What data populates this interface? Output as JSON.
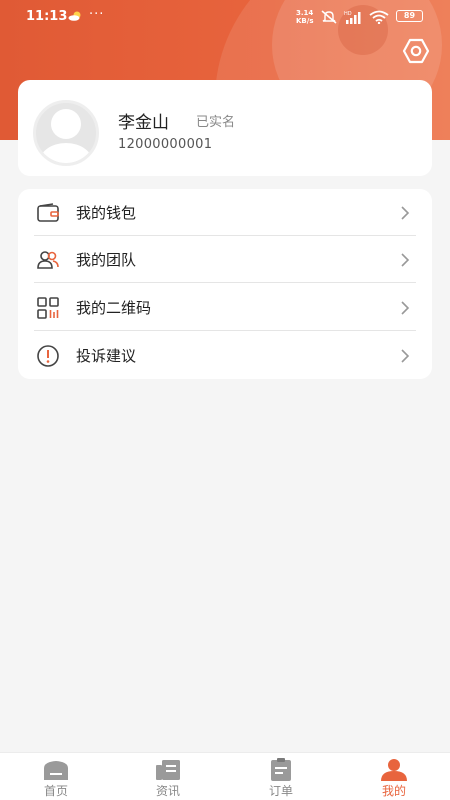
{
  "status_bar": {
    "time": "11:13",
    "more_dots": "···",
    "net_speed_value": "3.14",
    "net_speed_unit": "KB/s",
    "signal_label": "HD",
    "battery": "89"
  },
  "profile": {
    "name": "李金山",
    "verified_label": "已实名",
    "phone": "12000000001"
  },
  "menu": {
    "items": [
      {
        "label": "我的钱包",
        "icon": "wallet-icon"
      },
      {
        "label": "我的团队",
        "icon": "team-icon"
      },
      {
        "label": "我的二维码",
        "icon": "qrcode-icon"
      },
      {
        "label": "投诉建议",
        "icon": "complaint-icon"
      }
    ]
  },
  "tabbar": {
    "tabs": [
      {
        "label": "首页",
        "icon": "home-icon"
      },
      {
        "label": "资讯",
        "icon": "news-icon"
      },
      {
        "label": "订单",
        "icon": "order-icon"
      },
      {
        "label": "我的",
        "icon": "profile-icon",
        "active": true
      }
    ]
  },
  "colors": {
    "accent": "#e8643d",
    "header_start": "#e05a35",
    "header_end": "#ec7248",
    "background": "#f5f5f5",
    "tab_inactive": "#888888"
  }
}
